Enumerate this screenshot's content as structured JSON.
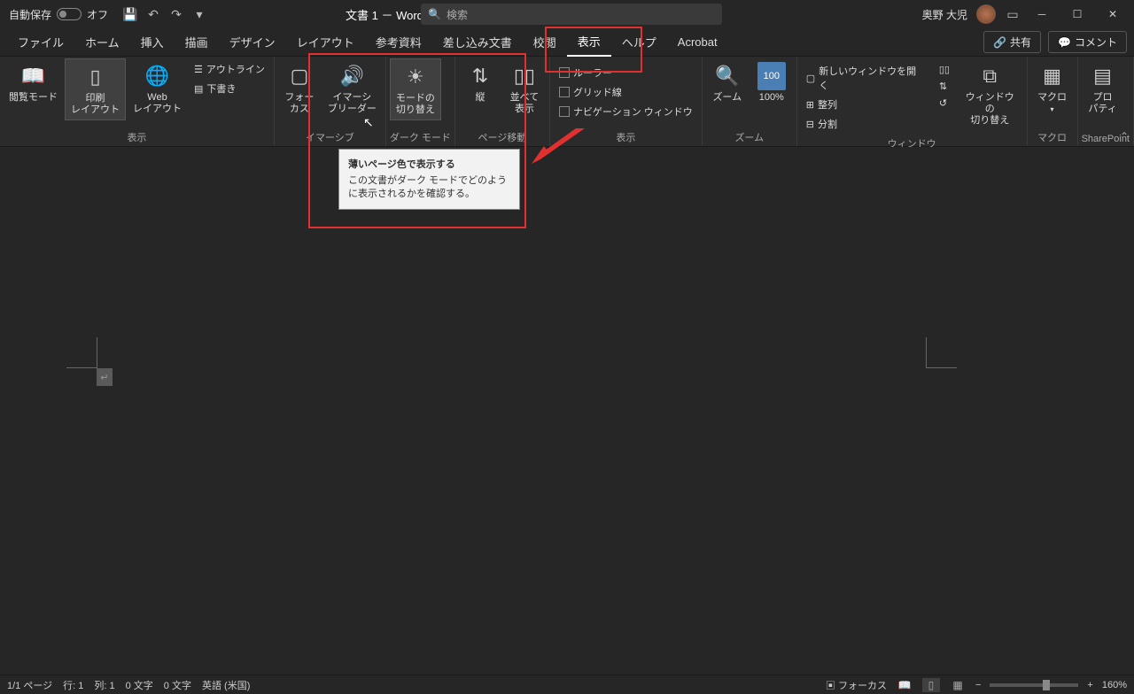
{
  "titlebar": {
    "autosave_label": "自動保存",
    "autosave_state": "オフ",
    "doc_title": "文書 1 － Word",
    "search_placeholder": "検索",
    "user_name": "奥野 大児"
  },
  "tabs": {
    "items": [
      "ファイル",
      "ホーム",
      "挿入",
      "描画",
      "デザイン",
      "レイアウト",
      "参考資料",
      "差し込み文書",
      "校閲",
      "表示",
      "ヘルプ",
      "Acrobat"
    ],
    "active_index": 9,
    "share": "共有",
    "comment": "コメント"
  },
  "ribbon": {
    "groups": {
      "view": {
        "label": "表示",
        "reading": "閲覧モード",
        "print": "印刷\nレイアウト",
        "web": "Web\nレイアウト",
        "outline": "アウトライン",
        "draft": "下書き"
      },
      "immersive": {
        "label": "イマーシブ",
        "focus": "フォー\nカス",
        "reader": "イマーシ\nブリーダー"
      },
      "darkmode": {
        "label": "ダーク モード",
        "toggle": "モードの\n切り替え"
      },
      "pagemove": {
        "label": "ページ移動",
        "vertical": "縦",
        "side": "並べて\n表示"
      },
      "show": {
        "label": "表示",
        "ruler": "ルーラー",
        "grid": "グリッド線",
        "nav": "ナビゲーション ウィンドウ"
      },
      "zoom": {
        "label": "ズーム",
        "zoom": "ズーム",
        "hundred": "100%"
      },
      "window": {
        "label": "ウィンドウ",
        "new": "新しいウィンドウを開く",
        "arrange": "整列",
        "split": "分割",
        "switch": "ウィンドウの\n切り替え"
      },
      "macro": {
        "label": "マクロ",
        "macro": "マクロ"
      },
      "sharepoint": {
        "label": "SharePoint",
        "prop": "プロ\nパティ"
      }
    }
  },
  "tooltip": {
    "title": "薄いページ色で表示する",
    "desc": "この文書がダーク モードでどのように表示されるかを確認する。"
  },
  "statusbar": {
    "page": "1/1 ページ",
    "line": "行: 1",
    "col": "列: 1",
    "words1": "0 文字",
    "words2": "0 文字",
    "lang": "英語 (米国)",
    "focus": "フォーカス",
    "zoom": "160%"
  }
}
